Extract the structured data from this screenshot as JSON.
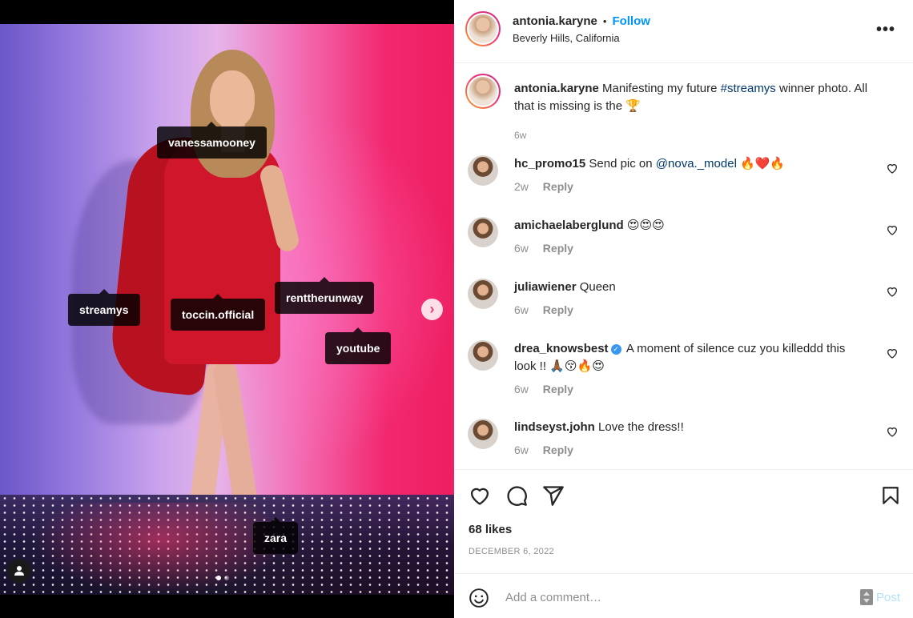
{
  "media": {
    "tags": [
      {
        "label": "vanessamooney"
      },
      {
        "label": "streamys"
      },
      {
        "label": "toccin.official"
      },
      {
        "label": "renttherunway"
      },
      {
        "label": "youtube"
      },
      {
        "label": "zara"
      }
    ],
    "carousel": {
      "total": 2,
      "current": 1
    }
  },
  "header": {
    "username": "antonia.karyne",
    "separator": "•",
    "follow_label": "Follow",
    "location": "Beverly Hills, California",
    "more_label": "•••"
  },
  "caption": {
    "username": "antonia.karyne",
    "text_before": "Manifesting my future",
    "hashtag": "#streamys",
    "text_after": "winner photo. All that is missing is the",
    "emoji": "🏆",
    "time": "6w"
  },
  "comments": [
    {
      "username": "hc_promo15",
      "text": "Send pic on",
      "mention": "@nova._model",
      "emoji": "🔥❤️🔥",
      "time": "2w",
      "reply": "Reply"
    },
    {
      "username": "amichaelaberglund",
      "text": "",
      "emoji": "😍😍😍",
      "time": "6w",
      "reply": "Reply"
    },
    {
      "username": "juliawiener",
      "text": "Queen",
      "emoji": "",
      "time": "6w",
      "reply": "Reply"
    },
    {
      "username": "drea_knowsbest",
      "verified": true,
      "text": "A moment of silence cuz you killeddd this look !!",
      "emoji": "🙏🏾😚🔥😍",
      "time": "6w",
      "reply": "Reply"
    },
    {
      "username": "lindseyst.john",
      "text": "Love the dress!!",
      "emoji": "",
      "time": "6w",
      "reply": "Reply"
    }
  ],
  "footer": {
    "likes": "68 likes",
    "date": "DECEMBER 6, 2022",
    "comment_placeholder": "Add a comment…",
    "post_label": "Post"
  },
  "colors": {
    "accent": "#0095f6",
    "post_disabled": "#b2dffc",
    "muted": "#8e8e8e",
    "link": "#00376b"
  },
  "icons": {
    "like": "heart-outline-icon",
    "comment": "comment-bubble-icon",
    "share": "paper-plane-icon",
    "save": "bookmark-icon",
    "emoji": "smiley-icon",
    "tag_user": "person-icon",
    "next": "chevron-right-icon"
  }
}
